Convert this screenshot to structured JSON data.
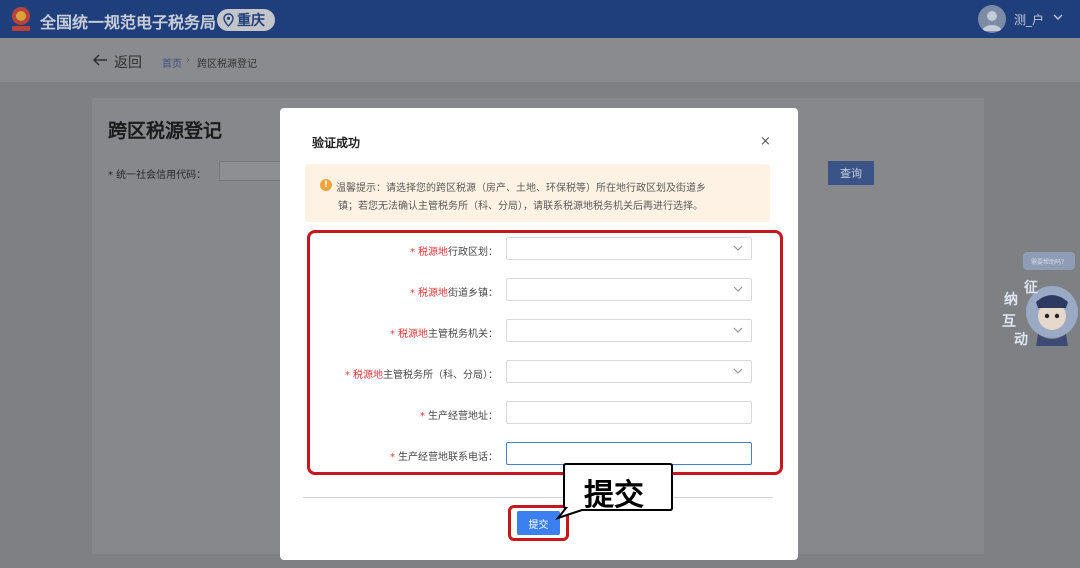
{
  "header": {
    "site_title": "全国统一规范电子税务局",
    "city": "重庆",
    "user_name": "测_户"
  },
  "subbar": {
    "back_label": "返回",
    "breadcrumb": [
      "首页",
      "›",
      "跨区税源登记"
    ]
  },
  "page": {
    "title": "跨区税源登记",
    "credit_code_label": "* 统一社会信用代码：",
    "query_label": "查询"
  },
  "helper": {
    "bubble_text": "需要帮助吗？",
    "badge_chars": [
      "征",
      "纳",
      "互",
      "动"
    ]
  },
  "modal": {
    "title": "验证成功",
    "close": "×",
    "notice_line1": "温馨提示：请选择您的跨区税源（房产、土地、环保税等）所在地行政区划及街道乡",
    "notice_line2": "镇；若您无法确认主管税务所（科、分局），请联系税源地税务机关后再进行选择。",
    "fields": [
      {
        "prefix": "税源地",
        "label": "行政区划：",
        "type": "select"
      },
      {
        "prefix": "税源地",
        "label": "街道乡镇：",
        "type": "select"
      },
      {
        "prefix": "税源地",
        "label": "主管税务机关：",
        "type": "select"
      },
      {
        "prefix": "税源地",
        "label": "主管税务所（科、分局）：",
        "type": "select"
      },
      {
        "prefix": "",
        "label": "生产经营地址：",
        "type": "text"
      },
      {
        "prefix": "",
        "label": "生产经营地联系电话：",
        "type": "text"
      }
    ],
    "submit_label": "提交",
    "callout_text": "提交"
  },
  "colors": {
    "header_bg": "#1f3f7c",
    "highlight_red": "#c7161d",
    "primary_blue": "#3c80f0",
    "notice_bg": "#fdf2e3"
  }
}
